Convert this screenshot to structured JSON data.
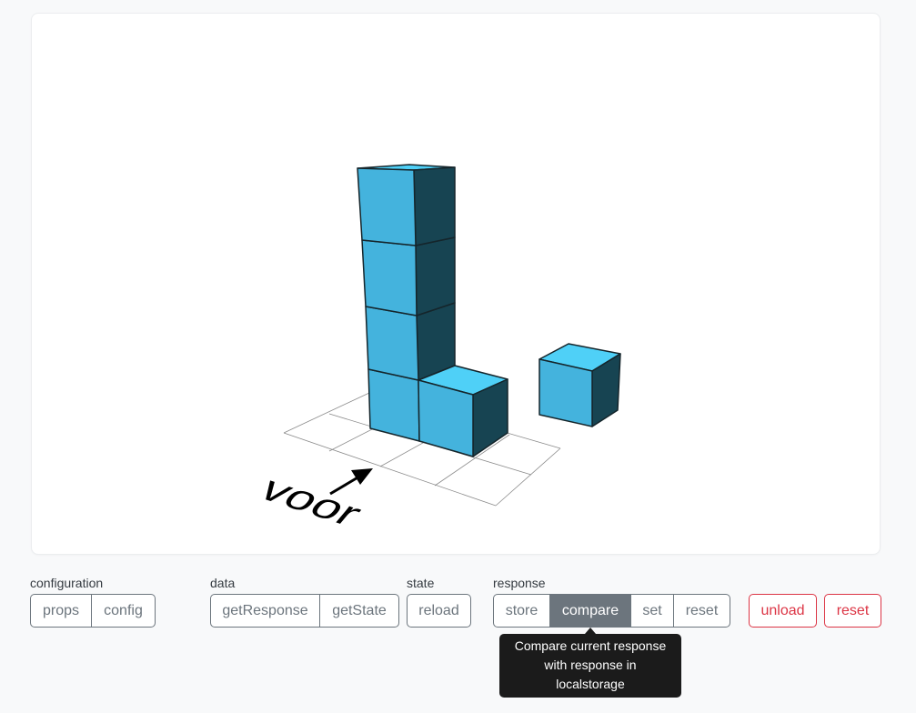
{
  "scene": {
    "direction_label": "voor",
    "colors": {
      "cube_front": "#44b3dd",
      "cube_top": "#4fd0f7",
      "cube_side": "#174452",
      "cube_edge": "#15252b",
      "grid_line": "#8a8a8a"
    }
  },
  "toolbar": {
    "configuration": {
      "label": "configuration",
      "buttons": [
        "props",
        "config"
      ]
    },
    "data": {
      "label": "data",
      "buttons": [
        "getResponse",
        "getState"
      ]
    },
    "state": {
      "label": "state",
      "buttons": [
        "reload"
      ]
    },
    "response": {
      "label": "response",
      "buttons": [
        "store",
        "compare",
        "set",
        "reset"
      ],
      "active": "compare"
    },
    "unload": "unload",
    "reset": "reset"
  },
  "tooltip": {
    "line1": "Compare current response",
    "line2": "with response in",
    "line3": "localstorage"
  },
  "colors": {
    "secondary": "#6c757d",
    "danger": "#dc3545",
    "tooltip_bg": "#1b1b1b"
  }
}
